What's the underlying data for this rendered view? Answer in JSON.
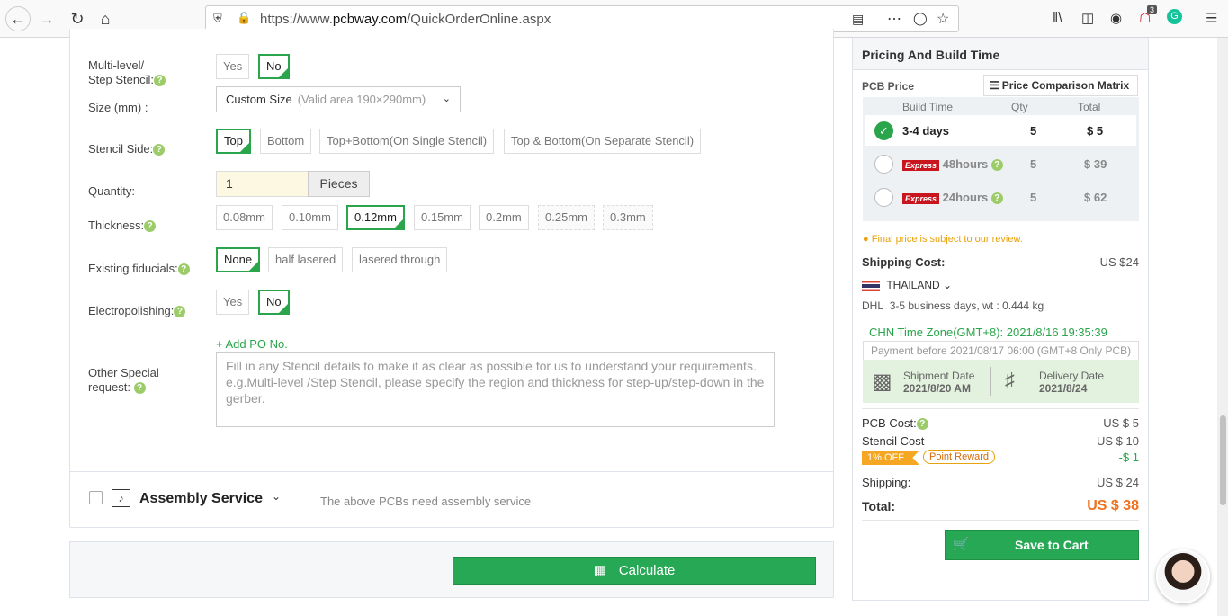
{
  "browser": {
    "url_prefix": "https://www.",
    "url_domain": "pcbway.com",
    "url_path": "/QuickOrderOnline.aspx",
    "badge_count": "3"
  },
  "form": {
    "multilevel": {
      "label_1": "Multi-level/",
      "label_2": "Step Stencil:",
      "options": [
        "Yes",
        "No"
      ],
      "selected": "No"
    },
    "size": {
      "label": "Size (mm) :",
      "value": "Custom Size",
      "hint": "(Valid area 190×290mm)"
    },
    "stencil_side": {
      "label": "Stencil Side:",
      "options": [
        "Top",
        "Bottom",
        "Top+Bottom(On Single Stencil)",
        "Top & Bottom(On Separate Stencil)"
      ],
      "selected": "Top"
    },
    "quantity": {
      "label": "Quantity:",
      "value": "1",
      "unit": "Pieces"
    },
    "thickness": {
      "label": "Thickness:",
      "options": [
        "0.08mm",
        "0.10mm",
        "0.12mm",
        "0.15mm",
        "0.2mm",
        "0.25mm",
        "0.3mm"
      ],
      "selected": "0.12mm"
    },
    "fiducials": {
      "label": "Existing fiducials:",
      "options": [
        "None",
        "half lasered",
        "lasered through"
      ],
      "selected": "None"
    },
    "electropolishing": {
      "label": "Electropolishing:",
      "options": [
        "Yes",
        "No"
      ],
      "selected": "No"
    },
    "add_po": "+ Add PO No.",
    "special": {
      "label_1": "Other Special",
      "label_2": "request:",
      "placeholder": "Fill in any Stencil details to make it as clear as possible for us to understand your requirements. e.g.Multi-level /Step Stencil, please specify the region and thickness for step-up/step-down in the gerber."
    }
  },
  "assembly": {
    "title": "Assembly Service",
    "note": "The above PCBs need assembly service"
  },
  "calculate_label": "Calculate",
  "pricing": {
    "title": "Pricing And Build Time",
    "pcb_price_label": "PCB Price",
    "matrix_label": "Price Comparison Matrix",
    "columns": [
      "Build Time",
      "Qty",
      "Total"
    ],
    "rows": [
      {
        "time": "3-4 days",
        "express": "",
        "qty": "5",
        "total": "$ 5"
      },
      {
        "time": "48hours",
        "express": "Express",
        "qty": "5",
        "total": "$ 39"
      },
      {
        "time": "24hours",
        "express": "Express",
        "qty": "5",
        "total": "$ 62"
      }
    ],
    "review_note": "Final price is subject to our review.",
    "shipping_cost_label": "Shipping Cost:",
    "shipping_cost": "US $24",
    "country": "THAILAND",
    "carrier": "DHL",
    "carrier_detail": "3-5 business days,   wt : 0.444 kg",
    "timezone": "CHN Time Zone(GMT+8): 2021/8/16 19:35:39",
    "payment_before": "Payment before 2021/08/17 06:00 (GMT+8 Only PCB)",
    "shipment_label": "Shipment Date",
    "shipment_date": "2021/8/20 AM",
    "delivery_label": "Delivery Date",
    "delivery_date": "2021/8/24",
    "pcb_cost_label": "PCB Cost:",
    "pcb_cost": "US $ 5",
    "stencil_cost_label": "Stencil Cost",
    "stencil_cost": "US $ 10",
    "discount_badge": "1% OFF",
    "point_reward": "Point Reward",
    "discount_value": "-$ 1",
    "shipping_label": "Shipping:",
    "shipping": "US $ 24",
    "total_label": "Total:",
    "total": "US $ 38",
    "cart_label": "Save to Cart"
  }
}
